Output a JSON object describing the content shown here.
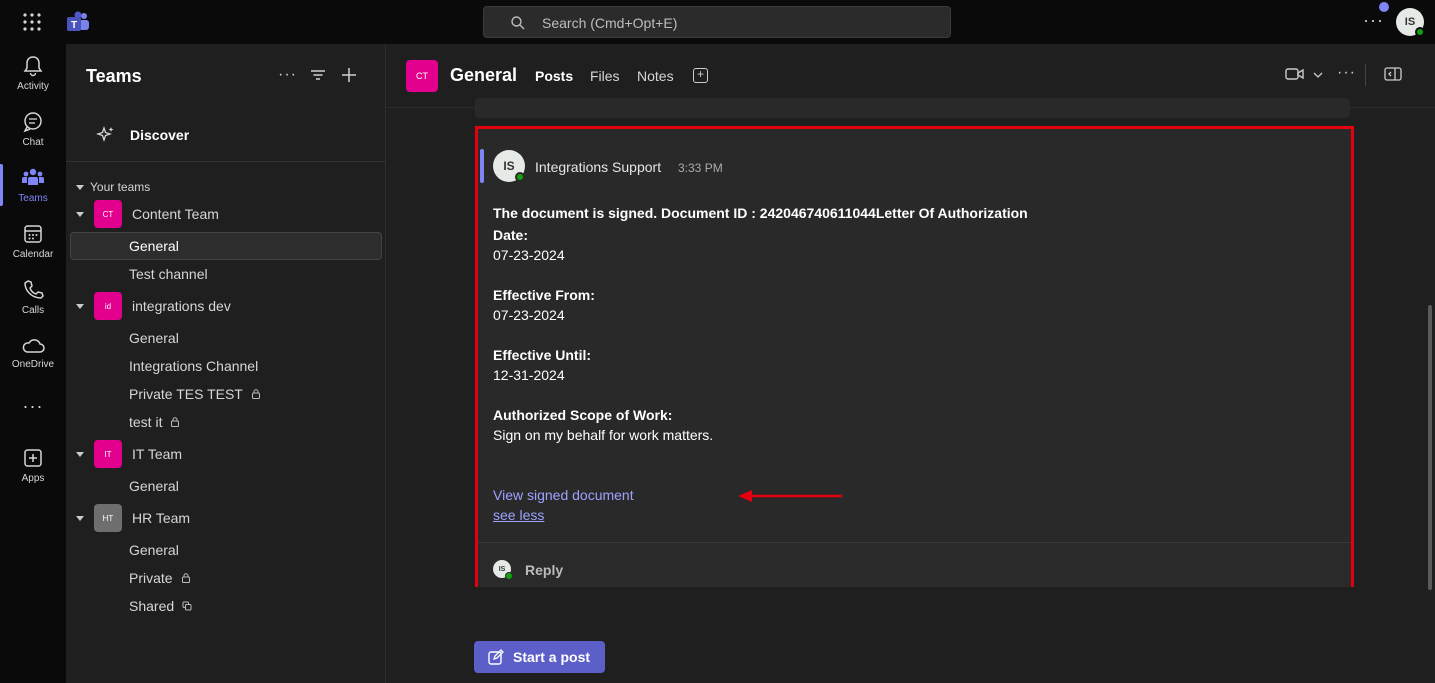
{
  "topbar": {
    "search_placeholder": "Search (Cmd+Opt+E)",
    "avatar_initials": "IS"
  },
  "rail": {
    "items": [
      {
        "label": "Activity",
        "icon": "bell-icon"
      },
      {
        "label": "Chat",
        "icon": "chat-icon"
      },
      {
        "label": "Teams",
        "icon": "teams-icon"
      },
      {
        "label": "Calendar",
        "icon": "calendar-icon"
      },
      {
        "label": "Calls",
        "icon": "phone-icon"
      },
      {
        "label": "OneDrive",
        "icon": "cloud-icon"
      },
      {
        "label": "Apps",
        "icon": "add-app-icon"
      }
    ]
  },
  "sidebar": {
    "title": "Teams",
    "discover": "Discover",
    "your_teams": "Your teams",
    "teams": [
      {
        "initials": "CT",
        "name": "Content Team",
        "color": "#e3008c",
        "channels": [
          {
            "name": "General",
            "selected": true
          },
          {
            "name": "Test channel"
          }
        ]
      },
      {
        "initials": "id",
        "name": "integrations dev",
        "color": "#e3008c",
        "channels": [
          {
            "name": "General"
          },
          {
            "name": "Integrations Channel"
          },
          {
            "name": "Private TES TEST",
            "private": true
          },
          {
            "name": "test it",
            "private": true
          }
        ]
      },
      {
        "initials": "IT",
        "name": "IT Team",
        "color": "#e3008c",
        "channels": [
          {
            "name": "General"
          }
        ]
      },
      {
        "initials": "HT",
        "name": "HR Team",
        "color": "#6e6e6e",
        "channels": [
          {
            "name": "General"
          },
          {
            "name": "Private",
            "private": true
          },
          {
            "name": "Shared",
            "shared": true
          }
        ]
      }
    ]
  },
  "header": {
    "tile": "CT",
    "title": "General",
    "tabs": [
      "Posts",
      "Files",
      "Notes"
    ]
  },
  "post": {
    "avatar": "IS",
    "author": "Integrations Support",
    "time": "3:33 PM",
    "headline": "The document is signed. Document ID : 242046740611044Letter Of Authorization",
    "date_label": "Date:",
    "date_value": "07-23-2024",
    "from_label": "Effective From:",
    "from_value": "07-23-2024",
    "until_label": "Effective Until:",
    "until_value": "12-31-2024",
    "scope_label": "Authorized Scope of Work:",
    "scope_value": "Sign on my behalf for work matters.",
    "link": "View signed document",
    "see_less": "see less",
    "reply": "Reply",
    "reply_avatar": "IS"
  },
  "start_post": "Start a post",
  "colors": {
    "accent": "#7f85f5",
    "highlight": "#e3000f",
    "team_pink": "#e3008c"
  }
}
